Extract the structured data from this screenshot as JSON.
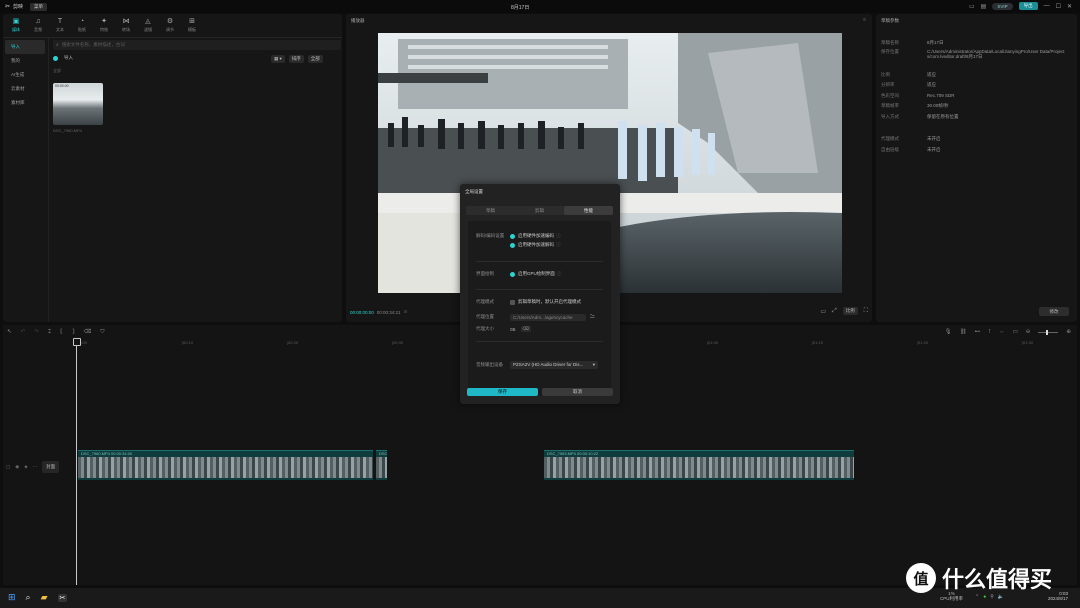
{
  "titlebar": {
    "app_name": "剪映",
    "menu": "菜单",
    "project_title": "8月17日",
    "feedback": "导出",
    "vip": "SVIP",
    "tb_icons": [
      "monitor-icon",
      "layout-icon"
    ]
  },
  "toolbar": [
    {
      "label": "媒体",
      "icon": "▣"
    },
    {
      "label": "音频",
      "icon": "♫"
    },
    {
      "label": "文本",
      "icon": "T"
    },
    {
      "label": "贴纸",
      "icon": "◔"
    },
    {
      "label": "特效",
      "icon": "✦"
    },
    {
      "label": "转场",
      "icon": "⋈"
    },
    {
      "label": "滤镜",
      "icon": "◬"
    },
    {
      "label": "调节",
      "icon": "⚙"
    },
    {
      "label": "模板",
      "icon": "⊞"
    }
  ],
  "sidebar": {
    "items": [
      {
        "label": "导入"
      },
      {
        "label": "我的"
      },
      {
        "label": "AI生成"
      },
      {
        "label": "云素材"
      },
      {
        "label": "素材库"
      }
    ]
  },
  "media": {
    "search_placeholder": "搜索文件名称，素材描述，台词",
    "import_label": "导入",
    "sort_label": "排序",
    "filter_label": "全部",
    "section": "全部",
    "thumb_label": "DSC_7960.MP4",
    "thumb_duration": "00:00:00"
  },
  "player": {
    "title": "播放器",
    "time_current": "00:00:00:00",
    "time_total": "00:00:34:21",
    "ratio": "比例"
  },
  "properties": {
    "title": "草稿参数",
    "rows": [
      {
        "k": "草稿名称",
        "v": "8月17日"
      },
      {
        "k": "保存位置",
        "v": "C:/Users/Administrator/AppData/Local/JianyingPro/User Data/Projects/com.lveditor.draft/8月17日"
      },
      {
        "k": "比例",
        "v": "适应"
      },
      {
        "k": "分辨率",
        "v": "适应"
      },
      {
        "k": "色彩空间",
        "v": "Rec.709 SDR"
      },
      {
        "k": "草稿帧率",
        "v": "30.00帧/秒"
      },
      {
        "k": "导入方式",
        "v": "保留在原有位置"
      },
      {
        "k": "代理模式",
        "v": "未开启"
      },
      {
        "k": "自由层级",
        "v": "未开启"
      }
    ],
    "edit_label": "修改"
  },
  "timeline": {
    "ticks": [
      "00:00",
      "|00:10",
      "|00:20",
      "|00:30",
      "|00:40",
      "|00:50",
      "|01:00",
      "|01:10",
      "|01:20",
      "|01:30"
    ],
    "cover_label": "封面",
    "clips": [
      {
        "label": "DSC_7960.MP4  00:00:34:00"
      },
      {
        "label": "DSC"
      },
      {
        "label": "DSC_7963.MP4  00:00:10:22"
      }
    ]
  },
  "dialog": {
    "title": "全局设置",
    "tabs": [
      "草稿",
      "剪辑",
      "性能"
    ],
    "active_tab": 2,
    "decode_label": "解码/编码设置",
    "hw_encode": "启用硬件加速编码",
    "hw_decode": "启用硬件加速解码",
    "render_label": "界面绘制",
    "gpu_label": "启用GPU绘制界面",
    "proxy_mode_label": "代理模式",
    "proxy_mode_value": "剪辑草稿时，默认开启代理模式",
    "proxy_location_label": "代理位置",
    "proxy_location_value": "C:/Users/Adm.../agencycache",
    "proxy_size_label": "代理大小",
    "proxy_size_value": "0B",
    "audio_label": "音频输出设备",
    "audio_value": "PZSA2V (HD Audio Driver for Dis...",
    "save_label": "保存",
    "cancel_label": "取消"
  },
  "taskbar": {
    "cpu": "1%",
    "cpu_label": "CPU利用率",
    "time": "0:03",
    "date": "2024/8/17"
  },
  "watermark": {
    "text": "什么值得买",
    "logo": "值"
  }
}
